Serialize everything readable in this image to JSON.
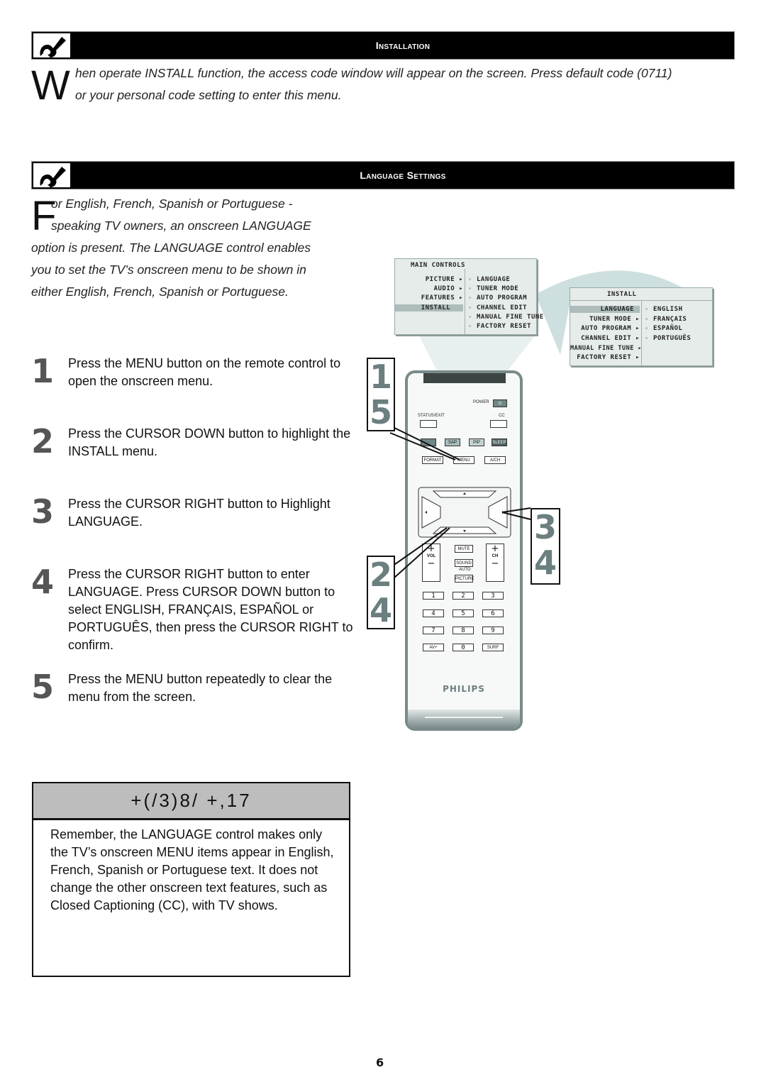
{
  "sections": {
    "installation": {
      "title": "Installation",
      "icon": "wrench-icon",
      "dropcap": "W",
      "text_line1": "hen operate INSTALL function, the access code window will appear on the screen. Press default code (0711)",
      "text_line2": "or your personal code setting to enter this menu."
    },
    "language_settings": {
      "title": "Language Settings",
      "icon": "wrench-icon",
      "dropcap": "F",
      "intro_line1": "or English, French, Spanish or Portuguese -",
      "intro_line2": "speaking TV owners, an onscreen LANGUAGE",
      "intro_line3": "option is present. The LANGUAGE control enables",
      "intro_line4": "you to set the TV’s onscreen menu to be shown in",
      "intro_line5": "either English, French, Spanish or Portuguese."
    }
  },
  "steps": [
    {
      "number": "1",
      "text": "Press the MENU button on the remote control to open the onscreen menu."
    },
    {
      "number": "2",
      "text": "Press the CURSOR DOWN button to highlight the INSTALL menu."
    },
    {
      "number": "3",
      "text": "Press the CURSOR RIGHT button to Highlight LANGUAGE."
    },
    {
      "number": "4",
      "text": "Press the CURSOR RIGHT button to enter LANGUAGE. Press CURSOR DOWN button to select ENGLISH, FRANÇAIS, ESPAÑOL or PORTUGUÊS, then press the CURSOR RIGHT to confirm."
    },
    {
      "number": "5",
      "text": "Press the MENU  button repeatedly to clear the menu from the screen."
    }
  ],
  "main_menu": {
    "title": "MAIN CONTROLS",
    "items": [
      "PICTURE",
      "AUDIO",
      "FEATURES",
      "INSTALL"
    ],
    "highlighted": "INSTALL",
    "submenu": [
      "LANGUAGE",
      "TUNER MODE",
      "AUTO PROGRAM",
      "CHANNEL EDIT",
      "MANUAL FINE TUNE",
      "FACTORY RESET"
    ]
  },
  "install_menu": {
    "title": "INSTALL",
    "items": [
      "LANGUAGE",
      "TUNER MODE",
      "AUTO PROGRAM",
      "CHANNEL EDIT",
      "MANUAL FINE TUNE",
      "FACTORY RESET"
    ],
    "highlighted": "LANGUAGE",
    "options": [
      "ENGLISH",
      "FRANÇAIS",
      "ESPAÑOL",
      "PORTUGUÊS"
    ]
  },
  "remote": {
    "power": "POWER",
    "status_exit": "STATUS/EXIT",
    "cc": "CC",
    "color_buttons": [
      "",
      "SAP",
      "PIP",
      "SLEEP"
    ],
    "format": "FORMAT",
    "menu": "MENU",
    "ach": "A/CH",
    "mute": "MUTE",
    "vol": "VOL",
    "ch": "CH",
    "sound": "SOUND",
    "auto": "AUTO",
    "picture": "PICTURE",
    "plus": "+",
    "minus": "−",
    "digits": [
      "1",
      "2",
      "3",
      "4",
      "5",
      "6",
      "7",
      "8",
      "9"
    ],
    "av": "AV+",
    "zero": "0",
    "surf": "SURF",
    "brand": "PHILIPS",
    "callouts": {
      "left_top": [
        "1",
        "5"
      ],
      "left_bottom": [
        "2",
        "4"
      ],
      "right": [
        "3",
        "4"
      ]
    }
  },
  "hint": {
    "title": "+(/3)8/  +,17",
    "body": "Remember, the LANGUAGE control makes only the TV’s onscreen MENU items appear in English, French, Spanish or Portuguese text. It does not change the other onscreen text features, such as Closed Captioning (CC), with TV shows."
  },
  "page_number": "6",
  "colors": {
    "bar": "#000000",
    "step_number": "#555555",
    "callout_number": "#6c7f80",
    "osd_bg": "#e6ecea",
    "osd_highlight": "#aebdbc",
    "hint_header": "#bdbdbd",
    "remote_frame": "#7a8a8a"
  }
}
